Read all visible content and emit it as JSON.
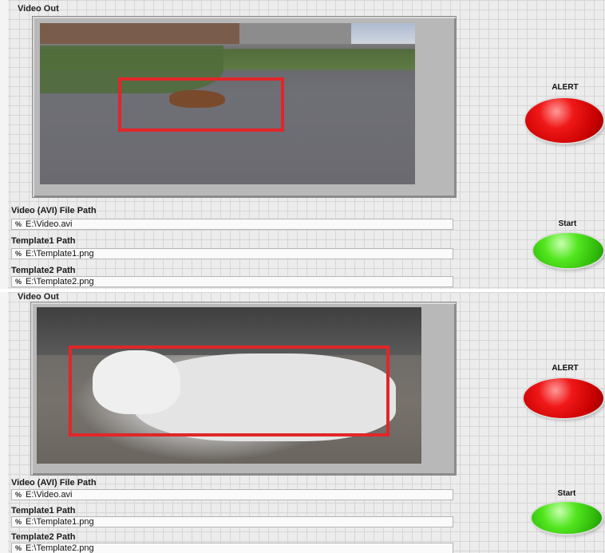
{
  "panels": [
    {
      "video_out_label": "Video Out",
      "alert_label": "ALERT",
      "start_label": "Start",
      "fields": [
        {
          "label": "Video (AVI) File Path",
          "value": "E:\\Video.avi"
        },
        {
          "label": "Template1 Path",
          "value": "E:\\Template1.png"
        },
        {
          "label": "Template2 Path",
          "value": "E:\\Template2.png"
        }
      ],
      "path_icon": "%",
      "alert_color": "#e41515",
      "start_color": "#3cd312"
    },
    {
      "video_out_label": "Video Out",
      "alert_label": "ALERT",
      "start_label": "Start",
      "fields": [
        {
          "label": "Video (AVI) File Path",
          "value": "E:\\Video.avi"
        },
        {
          "label": "Template1 Path",
          "value": "E:\\Template1.png"
        },
        {
          "label": "Template2 Path",
          "value": "E:\\Template2.png"
        }
      ],
      "path_icon": "%",
      "alert_color": "#e41515",
      "start_color": "#3cd312"
    }
  ],
  "detection_box_color": "#e1262a"
}
